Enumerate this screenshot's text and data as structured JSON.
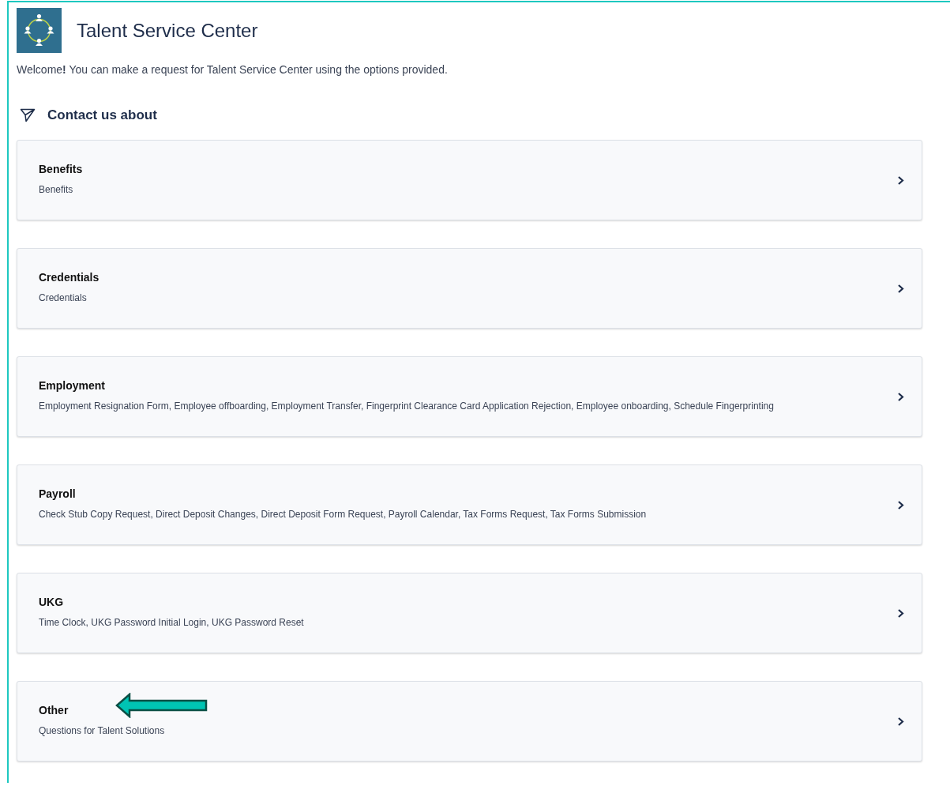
{
  "header": {
    "title": "Talent Service Center",
    "welcome": "Welcome**!** You can make a request for Talent Service Center using the options provided."
  },
  "section": {
    "title": "Contact us about"
  },
  "topics": [
    {
      "title": "Benefits",
      "description": "Benefits",
      "highlighted": false
    },
    {
      "title": "Credentials",
      "description": "Credentials",
      "highlighted": false
    },
    {
      "title": "Employment",
      "description": "Employment Resignation Form, Employee offboarding, Employment Transfer, Fingerprint Clearance Card Application Rejection, Employee onboarding, Schedule Fingerprinting",
      "highlighted": false
    },
    {
      "title": "Payroll",
      "description": "Check Stub Copy Request, Direct Deposit Changes, Direct Deposit Form Request, Payroll Calendar, Tax Forms Request, Tax Forms Submission",
      "highlighted": false
    },
    {
      "title": "UKG",
      "description": "Time Clock, UKG Password Initial Login, UKG Password Reset",
      "highlighted": false
    },
    {
      "title": "Other",
      "description": "Questions for Talent Solutions",
      "highlighted": true
    }
  ]
}
